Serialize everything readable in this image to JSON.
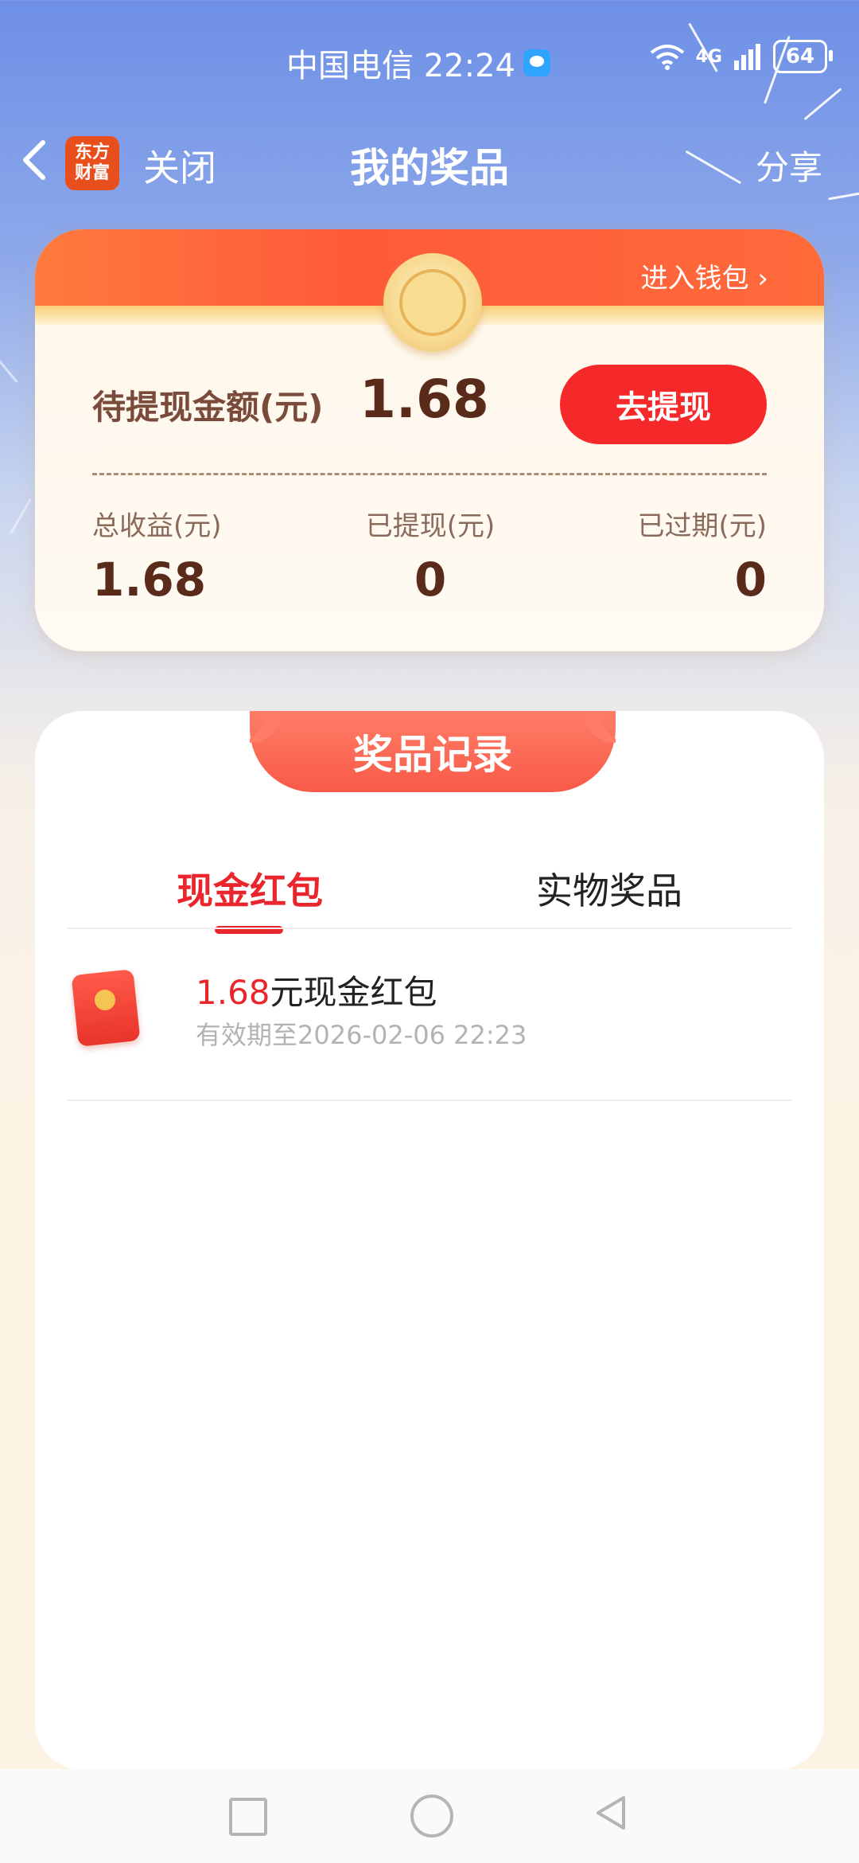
{
  "status_bar": {
    "carrier_time": "中国电信 22:24",
    "network": "4G",
    "battery": "64"
  },
  "nav": {
    "back_icon": "chevron-left-icon",
    "logo_text": "东方财富",
    "close_label": "关闭",
    "title": "我的奖品",
    "share_label": "分享"
  },
  "wallet": {
    "enter_wallet": "进入钱包 ›",
    "pending_label": "待提现金额(元)",
    "pending_value": "1.68",
    "withdraw_button": "去提现",
    "stats": [
      {
        "label": "总收益(元)",
        "value": "1.68"
      },
      {
        "label": "已提现(元)",
        "value": "0"
      },
      {
        "label": "已过期(元)",
        "value": "0"
      }
    ]
  },
  "records": {
    "header": "奖品记录",
    "tabs": [
      {
        "label": "现金红包",
        "active": true
      },
      {
        "label": "实物奖品",
        "active": false
      }
    ],
    "items": [
      {
        "amount": "1.68",
        "title_suffix": "元现金红包",
        "expiry": "有效期至2026-02-06 22:23",
        "icon": "red-envelope-icon"
      }
    ]
  },
  "system_nav": {
    "recent_icon": "square-icon",
    "home_icon": "circle-icon",
    "back_icon": "triangle-back-icon"
  },
  "colors": {
    "accent_red": "#e8262c",
    "button_red": "#f5282a",
    "amount_brown": "#5a2a1a"
  }
}
